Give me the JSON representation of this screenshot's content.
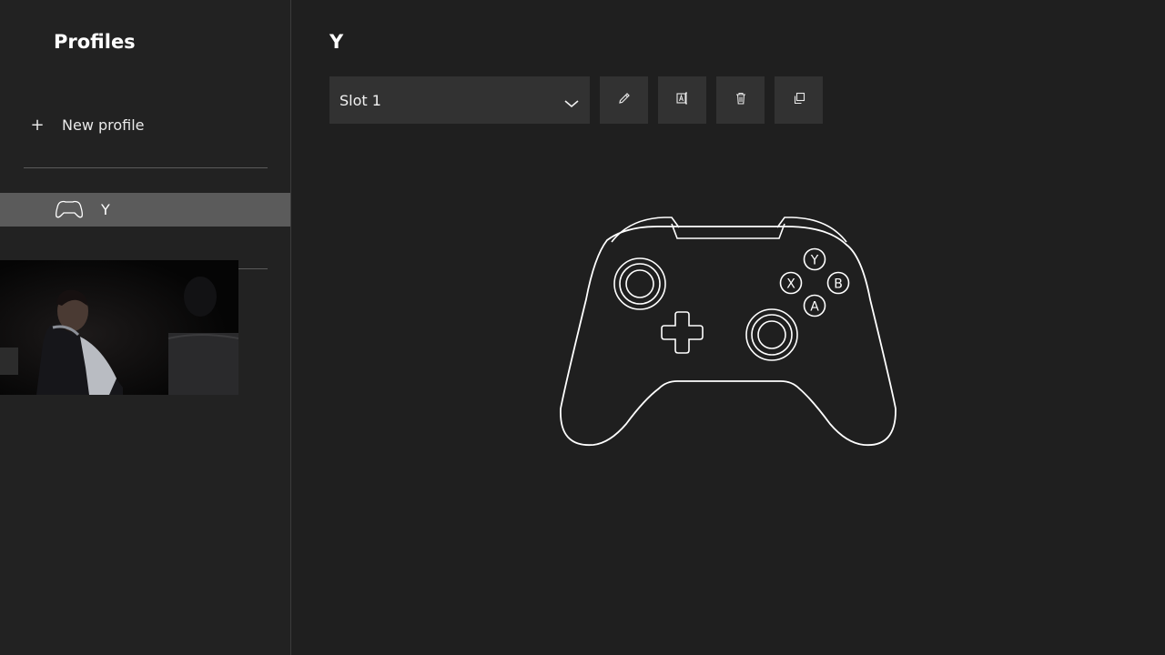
{
  "sidebar": {
    "title": "Profiles",
    "new_profile": {
      "icon": "plus-icon",
      "label": "New profile"
    },
    "profiles": [
      {
        "icon": "controller-icon",
        "label": "Y",
        "selected": true
      }
    ]
  },
  "main": {
    "title": "Y",
    "slot_select": {
      "value": "Slot 1",
      "icon": "chevron-down-icon"
    },
    "toolbar": [
      {
        "icon": "edit-pencil-icon"
      },
      {
        "icon": "rename-icon"
      },
      {
        "icon": "delete-trash-icon"
      },
      {
        "icon": "copy-icon"
      }
    ],
    "controller": {
      "face_buttons": {
        "y": "Y",
        "x": "X",
        "b": "B",
        "a": "A"
      }
    }
  },
  "colors": {
    "background": "#1f1f1f",
    "sidebar": "#222222",
    "selected_item": "#5b5b5b",
    "control_bg": "#323232",
    "text": "#ffffff"
  }
}
